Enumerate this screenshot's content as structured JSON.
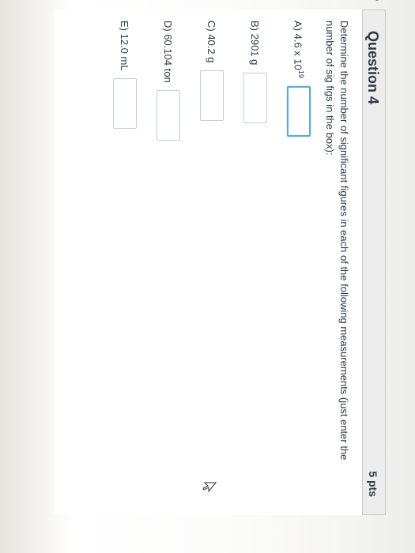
{
  "question": {
    "title": "Question 4",
    "points": "5 pts",
    "prompt": "Determine the number of significant figures in each of the following measurements (just enter the number of sig figs in the box):"
  },
  "items": [
    {
      "label": "A) 4.6 x 10",
      "exponent": "19",
      "answer": ""
    },
    {
      "label": "B) 2901 g",
      "answer": ""
    },
    {
      "label": "C) 40.2 g",
      "answer": ""
    },
    {
      "label": "D) 60.104 ton",
      "answer": ""
    },
    {
      "label": "E) 12.0 mL",
      "answer": ""
    }
  ],
  "icons": {
    "flag": "flag-icon",
    "cursor": "mouse-pointer-icon"
  },
  "colors": {
    "header_bg": "#ececec",
    "text": "#2d3b45",
    "focus": "#62a8d8"
  }
}
